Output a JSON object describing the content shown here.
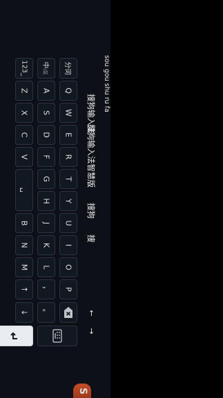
{
  "composition": {
    "text": "sou gou shu ru fa"
  },
  "candidates": [
    "搜狗输入法",
    "搜狗输入法智慧版",
    "搜狗",
    "搜"
  ],
  "candidate_nav": {
    "prev": "←",
    "next": "→"
  },
  "logo": {
    "letter": "S"
  },
  "keys": {
    "row1": [
      "Q",
      "W",
      "E",
      "R",
      "T",
      "Y",
      "U",
      "I",
      "O",
      "P"
    ],
    "row2": [
      "A",
      "S",
      "D",
      "F",
      "G",
      "H",
      "J",
      "K",
      "L",
      "，"
    ],
    "row3": [
      "Z",
      "X",
      "C",
      "V",
      "B",
      "N",
      "M",
      "。"
    ],
    "segment": "分词",
    "lang_main": "中",
    "lang_sub": "/英",
    "numbers": "123_",
    "space": "␣",
    "up": "↑",
    "down": "↓"
  },
  "colors": {
    "background": "#0d1117",
    "key": "#121820",
    "key_border": "#2b3440",
    "enter_key": "#e9edf1"
  }
}
